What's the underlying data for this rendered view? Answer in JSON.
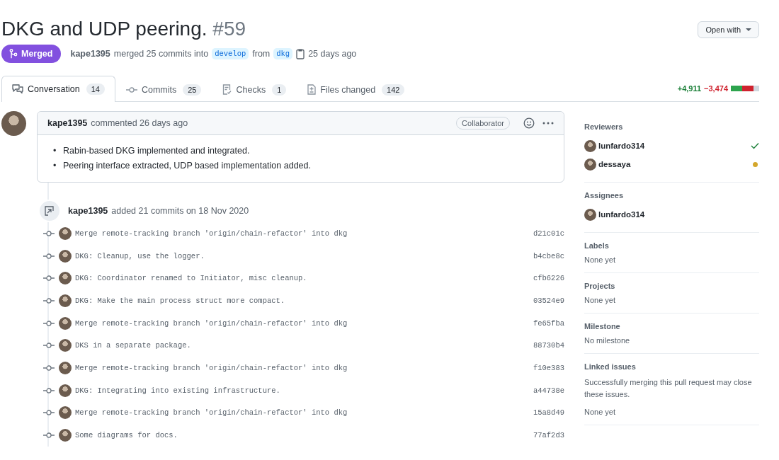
{
  "header": {
    "title": "DKG and UDP peering.",
    "number": "#59",
    "open_with": "Open with",
    "state": {
      "kind": "merged",
      "label": "Merged"
    },
    "author": "kape1395",
    "summary": "merged 25 commits into",
    "base_branch": "develop",
    "from": "from",
    "head_branch": "dkg",
    "time": "25 days ago"
  },
  "tabs": [
    {
      "label": "Conversation",
      "count": "14",
      "selected": true
    },
    {
      "label": "Commits",
      "count": "25",
      "selected": false
    },
    {
      "label": "Checks",
      "count": "1",
      "selected": false
    },
    {
      "label": "Files changed",
      "count": "142",
      "selected": false
    }
  ],
  "diffstat": {
    "additions": "+4,911",
    "deletions": "−3,474",
    "blocks": [
      {
        "kind": "added"
      },
      {
        "kind": "added"
      },
      {
        "kind": "deleted"
      },
      {
        "kind": "deleted"
      },
      {
        "kind": "neutral"
      }
    ]
  },
  "comment": {
    "author": "kape1395",
    "meta": "commented 26 days ago",
    "role": "Collaborator",
    "bullet": "•",
    "items": [
      "Rabin-based DKG implemented and integrated.",
      "Peering interface extracted, UDP based implementation added."
    ]
  },
  "commit_event": {
    "author": "kape1395",
    "text": "added 21 commits on 18 Nov 2020"
  },
  "commits": [
    {
      "message": "Merge remote-tracking branch 'origin/chain-refactor' into dkg",
      "sha": "d21c01c"
    },
    {
      "message": "DKG: Cleanup, use the logger.",
      "sha": "b4cbe8c"
    },
    {
      "message": "DKG: Coordinator renamed to Initiator, misc cleanup.",
      "sha": "cfb6226"
    },
    {
      "message": "DKG: Make the main process struct more compact.",
      "sha": "03524e9"
    },
    {
      "message": "Merge remote-tracking branch 'origin/chain-refactor' into dkg",
      "sha": "fe65fba"
    },
    {
      "message": "DKS in a separate package.",
      "sha": "88730b4"
    },
    {
      "message": "Merge remote-tracking branch 'origin/chain-refactor' into dkg",
      "sha": "f10e383"
    },
    {
      "message": "DKG: Integrating into existing infrastructure.",
      "sha": "a44738e"
    },
    {
      "message": "Merge remote-tracking branch 'origin/chain-refactor' into dkg",
      "sha": "15a8d49"
    },
    {
      "message": "Some diagrams for docs.",
      "sha": "77af2d3"
    }
  ],
  "sidebar": {
    "reviewers": {
      "heading": "Reviewers",
      "people": [
        {
          "name": "lunfardo314",
          "kind": "approved"
        },
        {
          "name": "dessaya",
          "kind": "pending"
        }
      ]
    },
    "assignees": {
      "heading": "Assignees",
      "people": [
        {
          "name": "lunfardo314"
        }
      ]
    },
    "sections": [
      {
        "heading": "Labels",
        "value": "None yet"
      },
      {
        "heading": "Projects",
        "value": "None yet"
      },
      {
        "heading": "Milestone",
        "value": "No milestone"
      }
    ],
    "linked_issues": {
      "heading": "Linked issues",
      "note": "Successfully merging this pull request may close these issues.",
      "value": "None yet"
    }
  }
}
